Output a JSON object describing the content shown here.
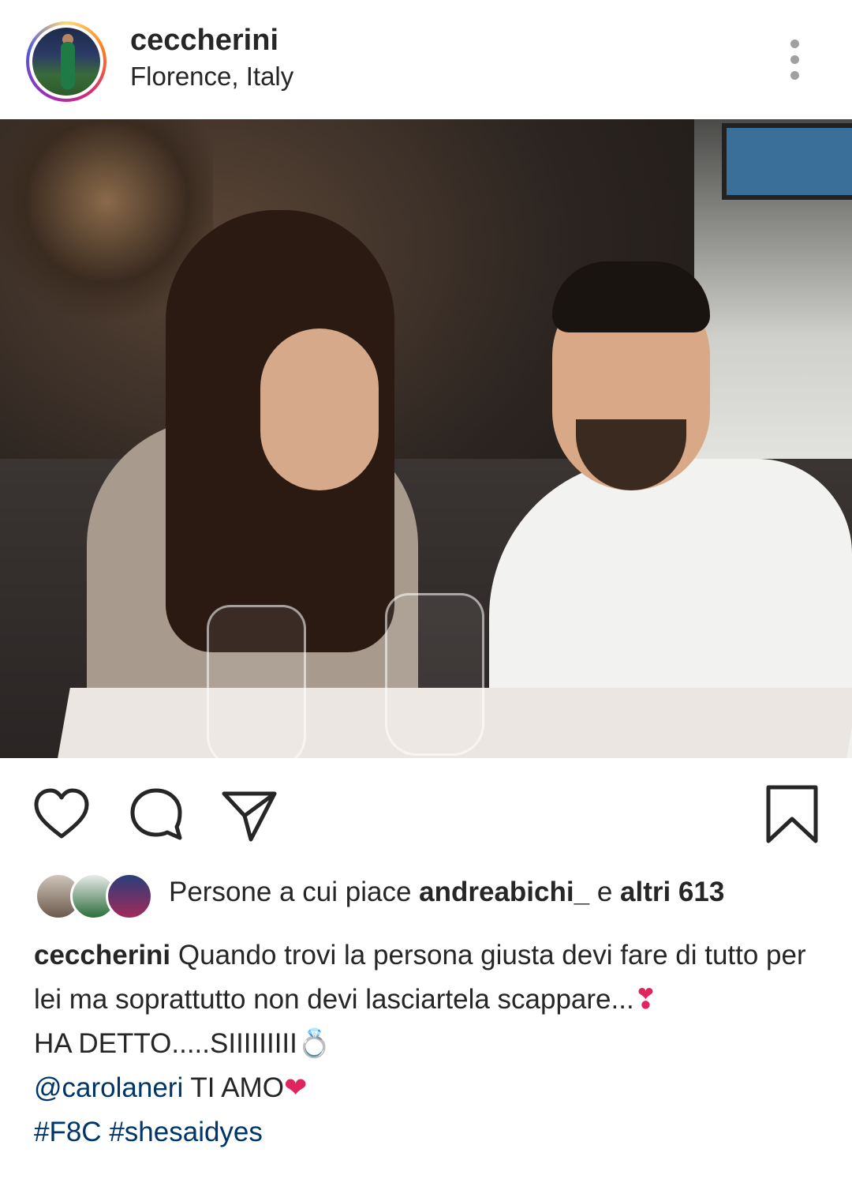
{
  "post": {
    "username": "ceccherini",
    "location": "Florence, Italy"
  },
  "icons": {
    "more": "more-vertical-icon",
    "like": "heart-icon",
    "comment": "comment-icon",
    "share": "send-icon",
    "save": "bookmark-icon"
  },
  "likes": {
    "prefix": "Persone a cui piace",
    "first_liker": "andreabichi_",
    "conjunction": "e",
    "others": "altri 613"
  },
  "caption": {
    "username": "ceccherini",
    "line1": "Quando trovi la persona giusta devi fare di tutto per lei ma soprattutto non devi lasciartela scappare...",
    "emoji1": "❣",
    "line2": "HA DETTO.....SIIIIIIIII",
    "emoji2": "💍",
    "mention": "@carolaneri",
    "line3": "TI AMO",
    "emoji3": "❤",
    "hashtag1": "#F8C",
    "hashtag2": "#shesaidyes"
  },
  "colors": {
    "text": "#262626",
    "link": "#003569",
    "muted": "#a0a0a0"
  }
}
